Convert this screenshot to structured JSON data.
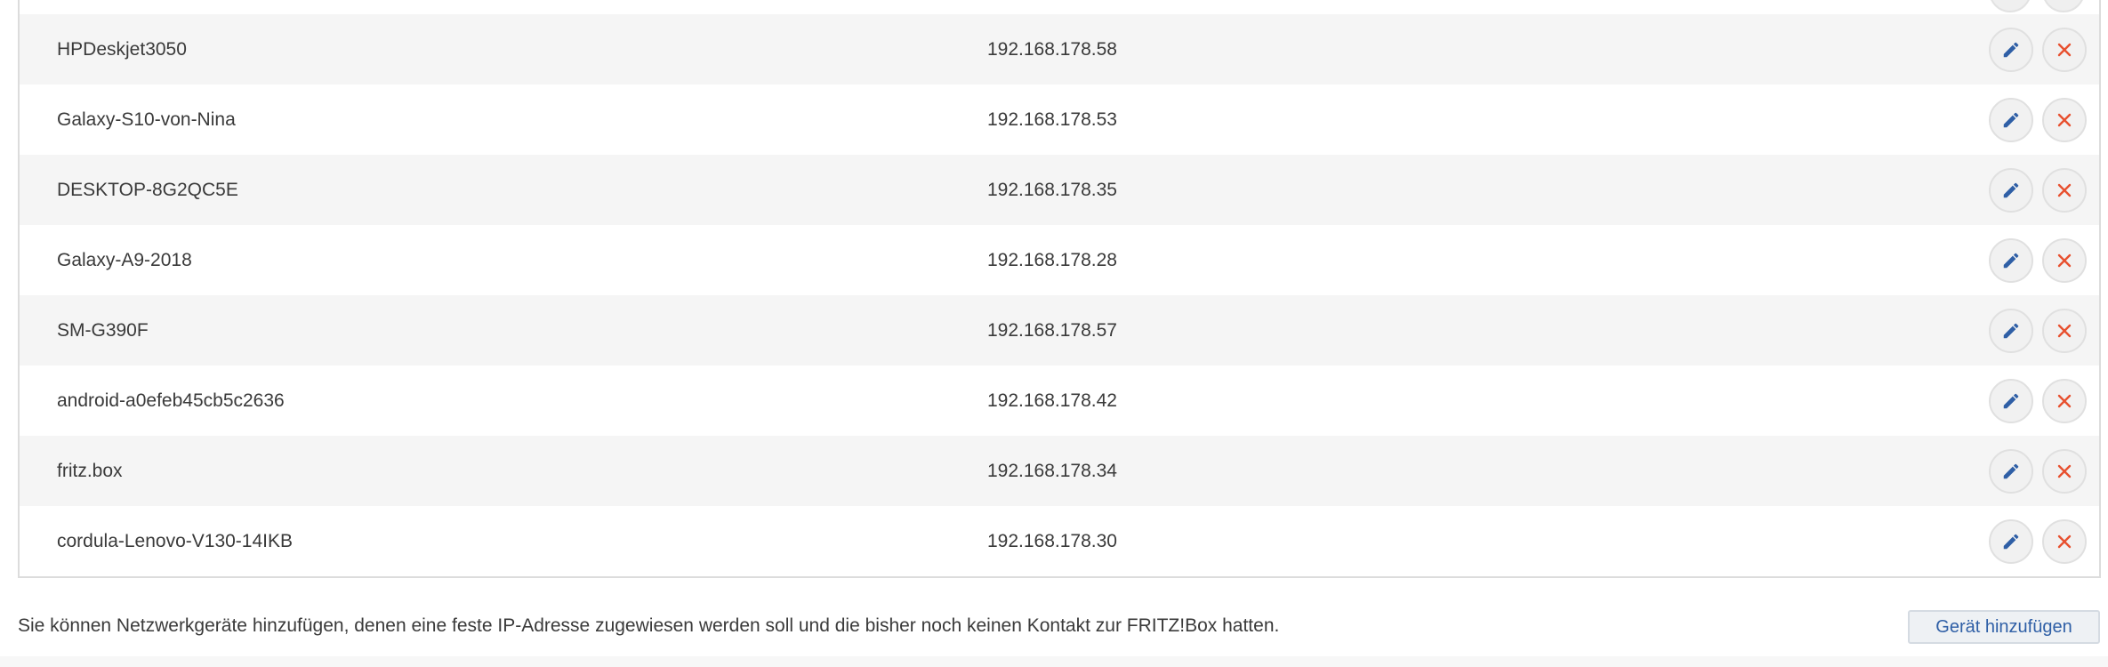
{
  "devices": [
    {
      "name": "HPDeskjet3050",
      "ip": "192.168.178.58"
    },
    {
      "name": "Galaxy-S10-von-Nina",
      "ip": "192.168.178.53"
    },
    {
      "name": "DESKTOP-8G2QC5E",
      "ip": "192.168.178.35"
    },
    {
      "name": "Galaxy-A9-2018",
      "ip": "192.168.178.28"
    },
    {
      "name": "SM-G390F",
      "ip": "192.168.178.57"
    },
    {
      "name": "android-a0efeb45cb5c2636",
      "ip": "192.168.178.42"
    },
    {
      "name": "fritz.box",
      "ip": "192.168.178.34"
    },
    {
      "name": "cordula-Lenovo-V130-14IKB",
      "ip": "192.168.178.30"
    }
  ],
  "icons": {
    "edit": "pencil-icon",
    "delete": "close-icon"
  },
  "colors": {
    "edit_icon": "#2f5fa6",
    "delete_icon": "#e8502f",
    "row_alt": "#f5f5f5"
  },
  "footer": {
    "info_text": "Sie können Netzwerkgeräte hinzufügen, denen eine feste IP-Adresse zugewiesen werden soll und die bisher noch keinen Kontakt zur FRITZ!Box hatten.",
    "add_button_label": "Gerät hinzufügen"
  }
}
